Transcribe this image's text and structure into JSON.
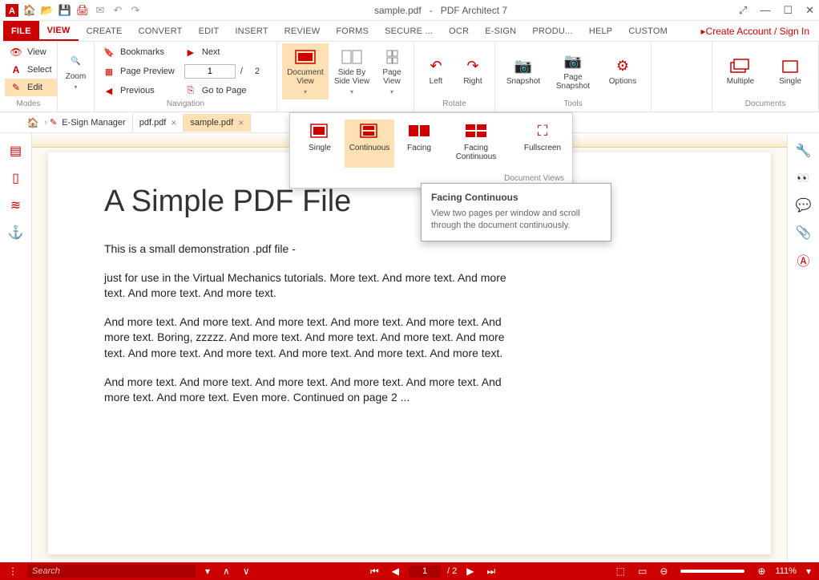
{
  "title": {
    "doc": "sample.pdf",
    "sep": "-",
    "app": "PDF Architect 7"
  },
  "account": "Create Account / Sign In",
  "menus": [
    "FILE",
    "VIEW",
    "CREATE",
    "CONVERT",
    "EDIT",
    "INSERT",
    "REVIEW",
    "FORMS",
    "SECURE ...",
    "OCR",
    "E-SIGN",
    "PRODU...",
    "HELP",
    "CUSTOM"
  ],
  "modes": {
    "view": "View",
    "select": "Select",
    "edit": "Edit",
    "group": "Modes"
  },
  "zoom": {
    "label": "Zoom"
  },
  "nav": {
    "bookmarks": "Bookmarks",
    "next": "Next",
    "preview": "Page Preview",
    "previous": "Previous",
    "goto": "Go to Page",
    "page": "1",
    "total": "2",
    "group": "Navigation",
    "slash": "/"
  },
  "views": {
    "docview": "Document View",
    "sbs": "Side By Side View",
    "pageview": "Page View"
  },
  "rotate": {
    "left": "Left",
    "right": "Right",
    "group": "Rotate"
  },
  "tools": {
    "snapshot": "Snapshot",
    "pagesnap": "Page Snapshot",
    "options": "Options",
    "group": "Tools"
  },
  "docs": {
    "multiple": "Multiple",
    "single": "Single",
    "group": "Documents"
  },
  "dropdown": {
    "single": "Single",
    "continuous": "Continuous",
    "facing": "Facing",
    "facingcont": "Facing Continuous",
    "fullscreen": "Fullscreen",
    "group": "Document Views"
  },
  "tooltip": {
    "title": "Facing Continuous",
    "body": "View two pages per window and scroll through the document continuously."
  },
  "tabs": {
    "esign": "E-Sign Manager",
    "pdf": "pdf.pdf",
    "sample": "sample.pdf"
  },
  "doc": {
    "h1": "A Simple PDF File",
    "p1": "This is a small demonstration .pdf file -",
    "p2": "just for use in the Virtual Mechanics tutorials. More text. And more text. And more text. And more text. And more text.",
    "p3": "And more text. And more text. And more text. And more text. And more text. And more text. Boring, zzzzz. And more text. And more text. And more text. And more text. And more text. And more text. And more text. And more text. And more text.",
    "p4": "And more text. And more text. And more text. And more text. And more text. And more text. And more text. Even more. Continued on page 2 ..."
  },
  "status": {
    "search": "Search",
    "page": "1",
    "total": "/ 2",
    "zoom": "111%"
  }
}
